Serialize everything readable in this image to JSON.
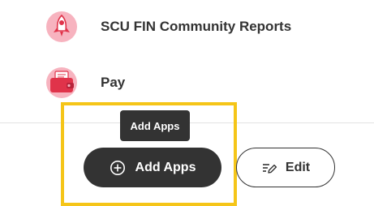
{
  "apps": [
    {
      "label": "SCU FIN Community Reports",
      "icon": "rocket-icon"
    },
    {
      "label": "Pay",
      "icon": "wallet-icon"
    }
  ],
  "tooltip": {
    "text": "Add Apps"
  },
  "actions": {
    "add_apps_label": "Add Apps",
    "add_apps_icon": "plus-circle-icon",
    "edit_label": "Edit",
    "edit_icon": "edit-icon"
  },
  "colors": {
    "icon_pink": "#f7b3bf",
    "icon_red": "#e0334a",
    "highlight": "#f5c518",
    "primary_button": "#333333"
  }
}
